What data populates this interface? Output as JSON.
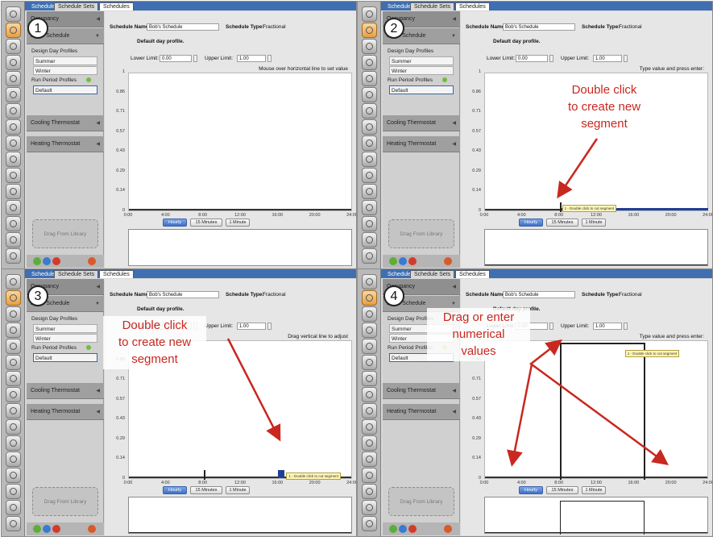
{
  "tabs": [
    "Schedules",
    "Schedule Sets",
    "Schedules"
  ],
  "header": {
    "name_label": "Schedule Name:",
    "name_value": "Bob's Schedule",
    "type_label": "Schedule Type:",
    "type_value": "Fractional",
    "profile_title": "Default day profile.",
    "lower_label": "Lower Limit:",
    "lower_value": "0.00",
    "upper_label": "Upper Limit:",
    "upper_value": "1.00"
  },
  "sidebar": {
    "header_top": "Occupancy",
    "header_bob": "Bob's Schedule",
    "design_day_label": "Design Day Profiles",
    "design_days": [
      "Summer",
      "Winter"
    ],
    "run_period_label": "Run Period Profiles",
    "run_periods": [
      "Default"
    ],
    "cooling": "Cooling Thermostat",
    "heating": "Heating Thermostat",
    "drag_text": "Drag From Library"
  },
  "hints": {
    "mouse_over": "Mouse over horizontal line to set value",
    "type_value": "Type value and press enter:",
    "drag_vertical": "Drag vertical line to adjust"
  },
  "tooltip_text": "1 - Double click to cut segment",
  "interval_buttons": [
    "Hourly",
    "15 Minutes",
    "1 Minute"
  ],
  "chart_axes": {
    "y_ticks": [
      "1",
      "0.86",
      "0.71",
      "0.57",
      "0.43",
      "0.29",
      "0.14",
      "0"
    ],
    "x_ticks": [
      "0:00",
      "4:00",
      "8:00",
      "12:00",
      "16:00",
      "20:00",
      "24:00"
    ]
  },
  "steps": [
    "1",
    "2",
    "3",
    "4"
  ],
  "annotations": {
    "p2": [
      "Double click",
      "to create new",
      "segment"
    ],
    "p3": [
      "Double click",
      "to create new",
      "segment"
    ],
    "p4": [
      "Drag or enter",
      "numerical",
      "values"
    ]
  },
  "colors": {
    "annotation": "#c8281f",
    "segment_fill": "#1f3f97",
    "accent_tab": "#3f6fb0"
  }
}
